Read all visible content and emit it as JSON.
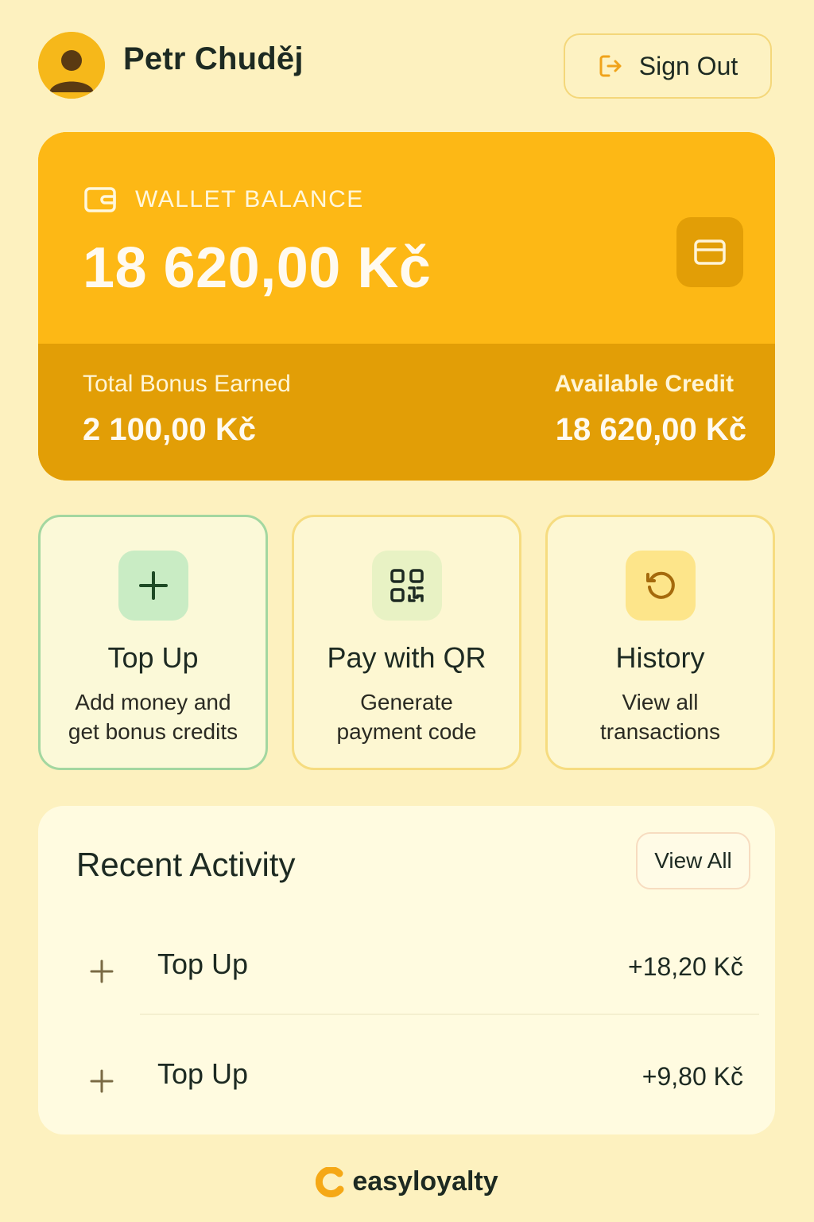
{
  "header": {
    "user_name": "Petr Chuděj",
    "signout_label": "Sign Out"
  },
  "wallet": {
    "label": "WALLET BALANCE",
    "balance": "18 620,00 Kč",
    "bonus_label": "Total Bonus Earned",
    "bonus_amount": "2 100,00 Kč",
    "credit_label": "Available Credit",
    "credit_amount": "18 620,00 Kč"
  },
  "actions": [
    {
      "title": "Top Up",
      "desc_line1": "Add money and",
      "desc_line2": "get bonus credits",
      "icon": "plus-icon"
    },
    {
      "title": "Pay with QR",
      "desc_line1": "Generate",
      "desc_line2": "payment code",
      "icon": "qr-code-icon"
    },
    {
      "title": "History",
      "desc_line1": "View all",
      "desc_line2": "transactions",
      "icon": "history-icon"
    }
  ],
  "activity": {
    "title": "Recent Activity",
    "view_all_label": "View All",
    "items": [
      {
        "name": "Top Up",
        "amount": "+18,20 Kč"
      },
      {
        "name": "Top Up",
        "amount": "+9,80 Kč"
      }
    ]
  },
  "footer": {
    "brand": "easyloyalty"
  },
  "colors": {
    "background": "#fdf1bf",
    "accent": "#fdb815",
    "accent_dark": "#e29e06",
    "text": "#1d2a22"
  }
}
